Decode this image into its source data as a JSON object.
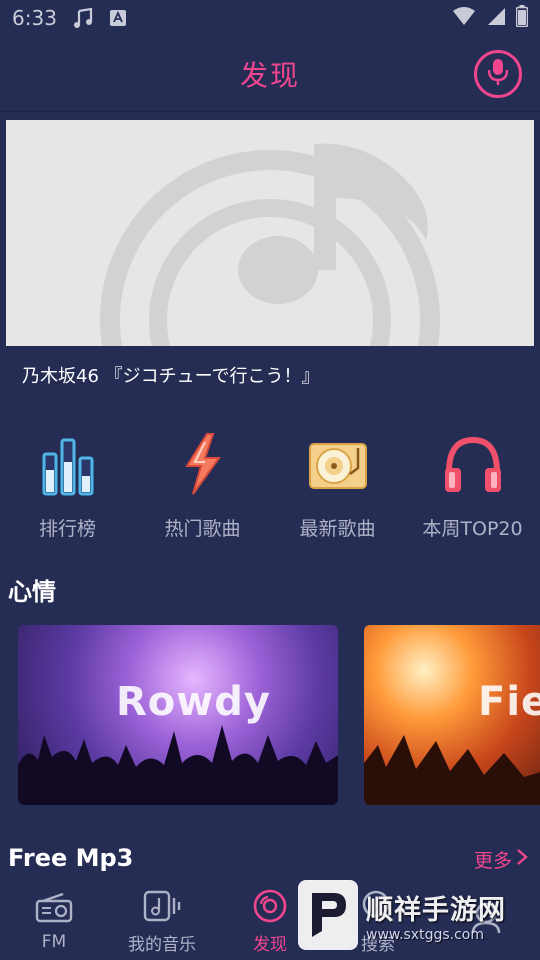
{
  "status_bar": {
    "time": "6:33"
  },
  "header": {
    "title": "发现"
  },
  "banner": {
    "caption": "乃木坂46 『ジコチューで行こう！』"
  },
  "categories": [
    {
      "label": "排行榜",
      "icon": "chart-bars-icon"
    },
    {
      "label": "热门歌曲",
      "icon": "lightning-icon"
    },
    {
      "label": "最新歌曲",
      "icon": "turntable-icon"
    },
    {
      "label": "本周TOP20",
      "icon": "headphones-icon"
    }
  ],
  "mood": {
    "title": "心情",
    "cards": [
      {
        "label": "Rowdy"
      },
      {
        "label": "Fier"
      }
    ]
  },
  "free_mp3": {
    "title": "Free Mp3",
    "more": "更多"
  },
  "bottom_nav": [
    {
      "label": "FM",
      "icon": "radio-icon"
    },
    {
      "label": "我的音乐",
      "icon": "music-note-icon"
    },
    {
      "label": "发现",
      "icon": "disc-icon",
      "active": true
    },
    {
      "label": "搜索",
      "icon": "search-icon"
    },
    {
      "label": "",
      "icon": "settings-icon"
    }
  ],
  "watermark": {
    "text": "顺祥手游网",
    "url": "www.sxtggs.com"
  },
  "colors": {
    "accent": "#f0468e",
    "background": "#262d55",
    "muted_text": "#aeb2c6"
  }
}
